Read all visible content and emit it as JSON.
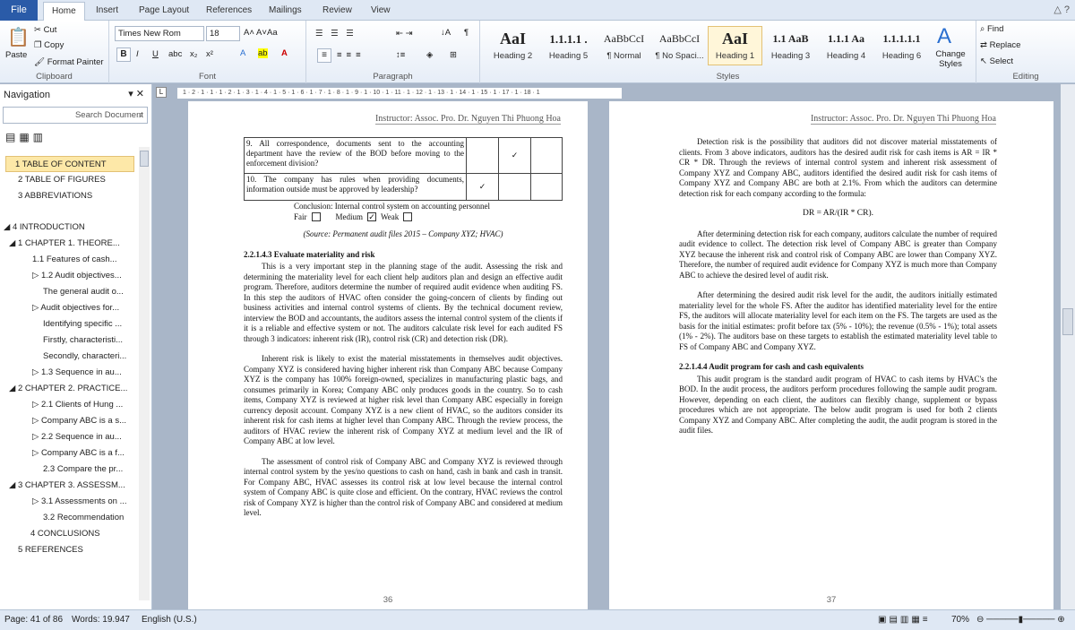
{
  "tabs": {
    "file": "File",
    "items": [
      "Home",
      "Insert",
      "Page Layout",
      "References",
      "Mailings",
      "Review",
      "View"
    ]
  },
  "clipboard": {
    "paste": "Paste",
    "cut": "Cut",
    "copy": "Copy",
    "format_painter": "Format Painter",
    "label": "Clipboard"
  },
  "font": {
    "name": "Times New Rom",
    "size": "18",
    "label": "Font",
    "aa": "Aa"
  },
  "paragraph": {
    "label": "Paragraph"
  },
  "styles": {
    "label": "Styles",
    "items": [
      {
        "preview": "AaI",
        "name": "Heading 2"
      },
      {
        "preview": "1.1.1.1 .",
        "name": "Heading 5"
      },
      {
        "preview": "AaBbCcI",
        "name": "¶ Normal"
      },
      {
        "preview": "AaBbCcI",
        "name": "¶ No Spaci..."
      },
      {
        "preview": "AaI",
        "name": "Heading 1"
      },
      {
        "preview": "1.1 AaB",
        "name": "Heading 3"
      },
      {
        "preview": "1.1.1 Aa",
        "name": "Heading 4"
      },
      {
        "preview": "1.1.1.1.1",
        "name": "Heading 6"
      }
    ],
    "change": "Change Styles"
  },
  "editing": {
    "find": "Find",
    "replace": "Replace",
    "select": "Select",
    "label": "Editing"
  },
  "nav": {
    "title": "Navigation",
    "search_placeholder": "Search Document",
    "items": [
      "1 TABLE OF CONTENT",
      "2 TABLE OF FIGURES",
      "3 ABBREVIATIONS",
      "4 INTRODUCTION",
      "1 CHAPTER 1. THEORE...",
      "1.1 Features of cash...",
      "1.2 Audit objectives...",
      "The general audit o...",
      "Audit objectives for...",
      "Identifying specific ...",
      "Firstly, characteristi...",
      "Secondly, characteri...",
      "1.3 Sequence in au...",
      "2 CHAPTER 2. PRACTICE...",
      "2.1 Clients of Hung ...",
      "Company ABC is a s...",
      "2.2 Sequence in au...",
      "Company ABC is a f...",
      "2.3 Compare the pr...",
      "3 CHAPTER 3. ASSESSM...",
      "3.1 Assessments on ...",
      "3.2 Recommendation",
      "4 CONCLUSIONS",
      "5 REFERENCES"
    ]
  },
  "ruler_text": "1 · 2 · 1 · 1 · 1 · 2 · 1 · 3 · 1 · 4 · 1 · 5 · 1 · 6 · 1 · 7 · 1 · 8 · 1 · 9 · 1 · 10 · 1 · 11 · 1 · 12 · 1 · 13 · 1 · 14 · 1 · 15 · 1 · 17 · 1 · 18 · 1",
  "page36": {
    "header": "Instructor: Assoc. Pro. Dr. Nguyen Thi Phuong Hoa",
    "row9": "9. All correspondence, documents sent to the accounting department have the review of the BOD before moving to the enforcement division?",
    "row10": "10. The company has rules when providing documents, information outside must be approved by leadership?",
    "check": "✓",
    "conclusion": "Conclusion: Internal control system on accounting personnel",
    "fair": "Fair",
    "medium": "Medium",
    "weak": "Weak",
    "source": "(Source: Permanent audit files 2015 – Company XYZ; HVAC)",
    "heading": "2.2.1.4.3 Evaluate materiality and risk",
    "p1": "This is a very important step in the planning stage of the audit. Assessing the risk and determining the materiality level for each client help auditors plan and design an effective audit program. Therefore, auditors determine the number of required audit evidence when auditing FS. In this step the auditors of HVAC often consider the going-concern of clients by finding out business activities and internal control systems of clients. By the technical document review, interview the BOD and accountants, the auditors assess the internal control system of the clients if it is a reliable and effective system or not. The auditors calculate risk level for each audited FS through 3 indicators: inherent risk (IR), control risk (CR) and detection risk (DR).",
    "p2": "Inherent risk is likely to exist the material misstatements in themselves audit objectives. Company XYZ is considered having higher inherent risk than Company ABC because Company XYZ is the company has 100% foreign-owned, specializes in manufacturing plastic bags, and consumes primarily in Korea; Company ABC only produces goods in the country. So to cash items, Company XYZ is reviewed at higher risk level than Company ABC especially in foreign currency deposit account. Company XYZ is a new client of HVAC, so the auditors consider its inherent risk for cash items at higher level than Company ABC. Through the review process, the auditors of HVAC review the inherent risk of Company XYZ at medium level and the IR of Company ABC at low level.",
    "p3": "The assessment of control risk of Company ABC and Company XYZ is reviewed through internal control system by the yes/no questions to cash on hand, cash in bank and cash in transit. For Company ABC, HVAC assesses its control risk at low level because the internal control system of Company ABC is quite close and efficient. On the contrary, HVAC reviews the control risk of Company XYZ is higher than the control risk of Company ABC and considered at medium level.",
    "page_number": "36"
  },
  "page37": {
    "header": "Instructor: Assoc. Pro. Dr. Nguyen Thi Phuong Hoa",
    "p1": "Detection risk is the possibility that auditors did not discover material misstatements of clients. From 3 above indicators, auditors has the desired audit risk for cash items is AR = IR * CR * DR. Through the reviews of internal control system and inherent risk assessment of Company XYZ and Company ABC, auditors identified the desired audit risk for cash items of Company XYZ and Company ABC are both at 2.1%. From which the auditors can determine detection risk for each company according to the formula:",
    "formula": "DR = AR/(IR * CR).",
    "p2": "After determining detection risk for each company, auditors calculate the number of required audit evidence to collect. The detection risk level of Company ABC is greater than Company XYZ because the inherent risk and control risk of Company ABC are lower than Company XYZ. Therefore, the number of required audit evidence for Company XYZ is much more than Company ABC to achieve the desired level of audit risk.",
    "p3": "After determining the desired audit risk level for the audit, the auditors initially estimated materiality level for the whole FS. After the auditor has identified materiality level for the entire FS, the auditors will allocate materiality level for each item on the FS. The targets are used as the basis for the initial estimates: profit before tax (5% - 10%); the revenue (0.5% - 1%); total assets (1% - 2%). The auditors base on these targets to establish the estimated materiality level table to FS of Company ABC and Company XYZ.",
    "heading": "2.2.1.4.4 Audit program for cash and cash equivalents",
    "p4": "This audit program is the standard audit program of HVAC to cash items by HVAC's the BOD. In the audit process, the auditors perform procedures following the sample audit program. However, depending on each client, the auditors can flexibly change, supplement or bypass procedures which are not appropriate. The below audit program is used for both 2 clients Company XYZ and Company ABC. After completing the audit, the audit program is stored in the audit files.",
    "page_number": "37"
  },
  "status": {
    "page": "Page: 41 of 86",
    "words": "Words: 19.947",
    "lang": "English (U.S.)",
    "zoom": "70%"
  }
}
